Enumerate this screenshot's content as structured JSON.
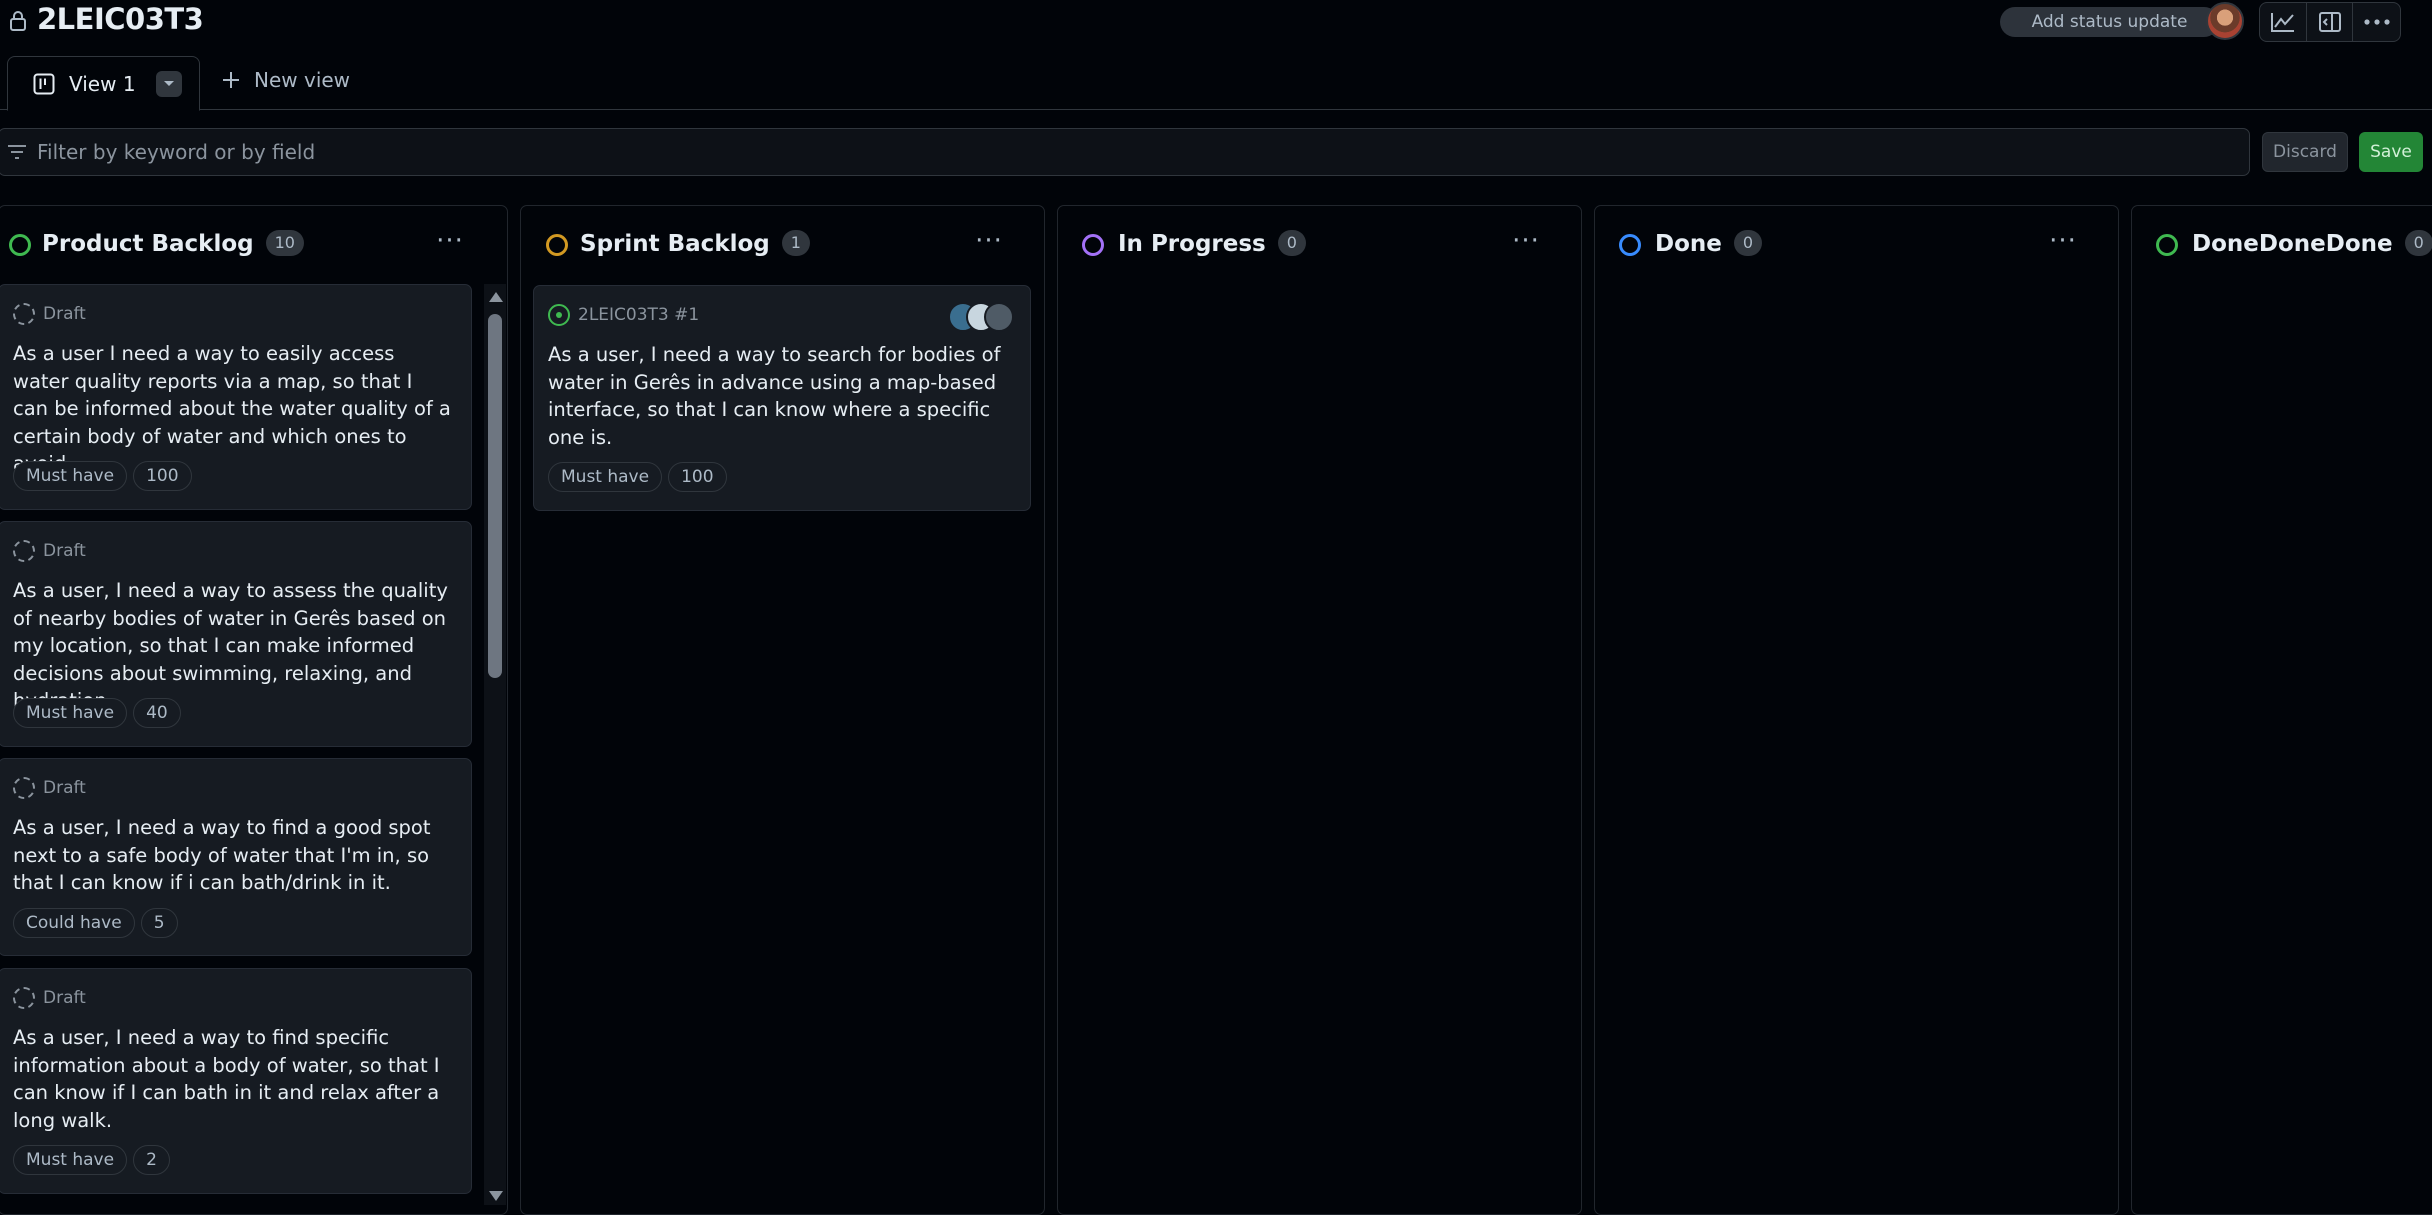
{
  "project": {
    "title": "2LEIC03T3"
  },
  "header": {
    "status_button": "Add status update",
    "icons": [
      "lock-icon",
      "avatar",
      "insights-icon",
      "sidebar-toggle-icon",
      "kebab-menu-icon"
    ]
  },
  "views": {
    "active_tab": "View 1",
    "new_view_label": "New view"
  },
  "filter": {
    "placeholder": "Filter by keyword or by field",
    "value": "",
    "discard_label": "Discard",
    "save_label": "Save"
  },
  "colors": {
    "background": "#010409",
    "card": "#161b22",
    "accent_green": "#238636",
    "status_product_backlog": "#3fb950",
    "status_sprint_backlog": "#d29922",
    "status_in_progress": "#a371f7",
    "status_done": "#388bfd",
    "status_donedonedone": "#3fb950"
  },
  "columns": [
    {
      "name": "Product Backlog",
      "count": "10",
      "cards": [
        {
          "meta": "Draft",
          "text": "As a user I need a way to easily access water quality reports via a map, so that I can be informed about the water quality of a certain body of water and which ones to avoid.",
          "priority": "Must have",
          "estimate": "100"
        },
        {
          "meta": "Draft",
          "text": "As a user, I need a way to assess the quality of nearby bodies of water in Gerês based on my location, so that I can make informed decisions about swimming, relaxing, and hydration.",
          "priority": "Must have",
          "estimate": "40"
        },
        {
          "meta": "Draft",
          "text": "As a user, I need a way to find a good spot next to a safe body of water that I'm in, so that I can know if i can bath/drink in it.",
          "priority": "Could have",
          "estimate": "5"
        },
        {
          "meta": "Draft",
          "text": "As a user, I need a way to find specific information about a body of water, so that I can know if I can bath in it and relax after a long walk.",
          "priority": "Must have",
          "estimate": "2"
        }
      ]
    },
    {
      "name": "Sprint Backlog",
      "count": "1",
      "cards": [
        {
          "meta": "2LEIC03T3 #1",
          "text": "As a user, I need a way to search for bodies of water in Gerês in advance using a map-based interface, so that I can know where a specific one is.",
          "priority": "Must have",
          "estimate": "100"
        }
      ]
    },
    {
      "name": "In Progress",
      "count": "0",
      "cards": []
    },
    {
      "name": "Done",
      "count": "0",
      "cards": []
    },
    {
      "name": "DoneDoneDone",
      "count": "0",
      "cards": []
    }
  ]
}
